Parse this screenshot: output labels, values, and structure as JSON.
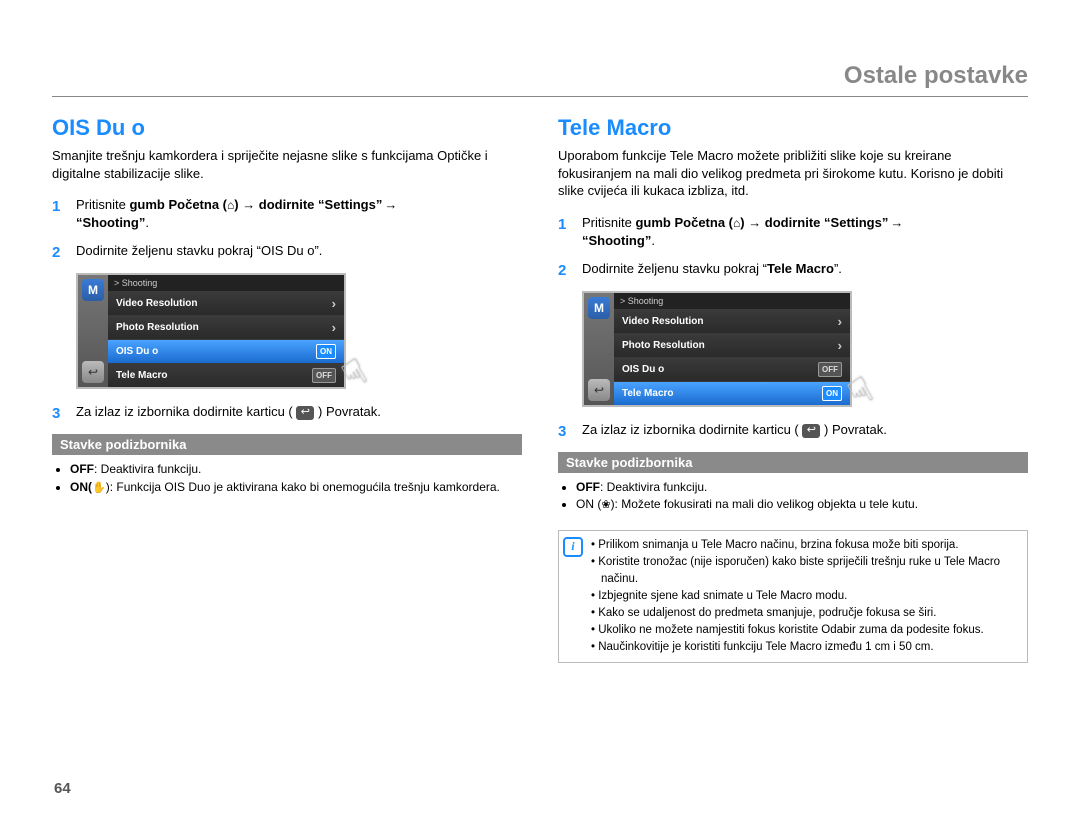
{
  "header": "Ostale postavke",
  "page_number": "64",
  "left": {
    "title": "OIS Du o",
    "intro": "Smanjite trešnju kamkordera i spriječite nejasne slike s funkcijama Optičke i digitalne stabilizacije slike.",
    "step1_pre": "Pritisnite",
    "step1_mid": "gumb Početna (",
    "step1_mid2": ") → dodirnite",
    "step1_settings": "“Settings”",
    "step1_arrow2": " → ",
    "step1_shooting": "“Shooting”",
    "step1_end": ".",
    "step2_pre": "Dodirnite željenu stavku pokraj “",
    "step2_mid": "OIS Du o",
    "step2_post": "”.",
    "step3_a": "Za izlaz iz izbornika dodirnite karticu (",
    "step3_b": ") Povratak.",
    "submenu_title": "Stavke podizbornika",
    "sub_items": [
      {
        "key": "OFF",
        "text": ": Deaktivira funkciju."
      },
      {
        "key": "ON(",
        "text": "): Funkcija OIS Duo je aktivirana kako bi onemogućila trešnju kamkordera."
      }
    ],
    "screen": {
      "breadcrumb": "> Shooting",
      "rows": [
        "Video Resolution",
        "Photo Resolution",
        "OIS Du o",
        "Tele Macro"
      ],
      "highlight_index": 2,
      "on_index": 2,
      "off_index": 3
    }
  },
  "right": {
    "title": "Tele Macro",
    "intro": "Uporabom funkcije Tele Macro možete približiti slike koje su kreirane fokusiranjem na mali dio velikog predmeta pri širokome kutu. Korisno je dobiti slike cvijeća ili kukaca izbliza, itd.",
    "step1_pre": "Pritisnite",
    "step1_mid": "gumb Početna (",
    "step1_mid2": ") → dodirnite",
    "step1_settings": "“Settings”",
    "step1_arrow2": " → ",
    "step1_shooting": "“Shooting”",
    "step1_end": ".",
    "step2_pre": "Dodirnite željenu stavku pokraj “",
    "step2_mid": "Tele Macro",
    "step2_post": "”.",
    "step3_a": "Za izlaz iz izbornika dodirnite karticu (",
    "step3_b": ") Povratak.",
    "submenu_title": "Stavke podizbornika",
    "sub_items": [
      {
        "key": "OFF",
        "text": ": Deaktivira funkciju."
      },
      {
        "key": "ON (",
        "text": "): Možete fokusirati na mali dio velikog objekta u tele kutu."
      }
    ],
    "screen": {
      "breadcrumb": "> Shooting",
      "rows": [
        "Video Resolution",
        "Photo Resolution",
        "OIS Du o",
        "Tele Macro"
      ],
      "highlight_index": 3,
      "on_index": 3,
      "off_index": 2
    },
    "notes": [
      "Prilikom snimanja u Tele Macro načinu, brzina fokusa može biti sporija.",
      "Koristite tronožac (nije isporučen) kako biste spriječili trešnju ruke u Tele Macro načinu.",
      "Izbjegnite sjene kad snimate u Tele Macro modu.",
      "Kako se udaljenost do predmeta smanjuje, područje fokusa se širi.",
      "Ukoliko ne možete namjestiti fokus koristite Odabir zuma da podesite fokus.",
      "Naučinkovitije je koristiti funkciju Tele Macro između 1 cm i 50 cm."
    ]
  }
}
